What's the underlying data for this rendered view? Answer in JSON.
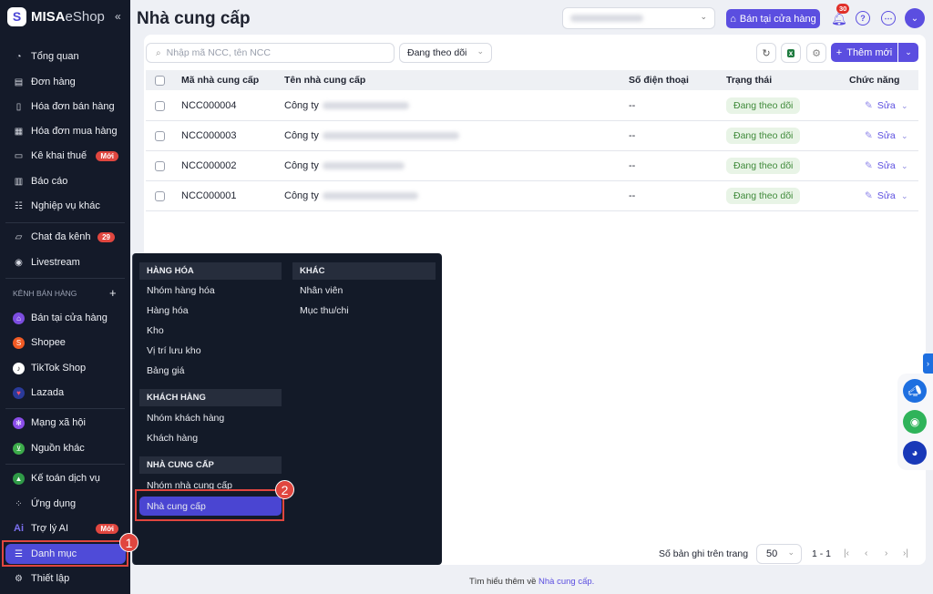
{
  "app": {
    "logo_mark": "S",
    "logo_brand": "MISA",
    "logo_product": "eShop",
    "collapse_icon": "«"
  },
  "sidebar": {
    "items": [
      {
        "label": "Tổng quan",
        "icon": "dashboard-icon"
      },
      {
        "label": "Đơn hàng",
        "icon": "order-icon"
      },
      {
        "label": "Hóa đơn bán hàng",
        "icon": "invoice-icon"
      },
      {
        "label": "Hóa đơn mua hàng",
        "icon": "receipt-icon"
      },
      {
        "label": "Kê khai thuế",
        "icon": "tax-icon",
        "badge": "Mới"
      },
      {
        "label": "Báo cáo",
        "icon": "report-icon"
      },
      {
        "label": "Nghiệp vụ khác",
        "icon": "list-icon"
      },
      {
        "label": "Chat đa kênh",
        "icon": "chat-icon",
        "badge": "29"
      },
      {
        "label": "Livestream",
        "icon": "livestream-icon"
      }
    ],
    "channels_label": "KÊNH BÁN HÀNG",
    "channels": [
      {
        "label": "Bán tại cửa hàng",
        "color": "#7c4de0"
      },
      {
        "label": "Shopee",
        "color": "#f05a24"
      },
      {
        "label": "TikTok Shop",
        "color": "#ffffff"
      },
      {
        "label": "Lazada",
        "color": "#2a3a9a"
      },
      {
        "label": "Mạng xã hội",
        "color": "#8a4de8"
      },
      {
        "label": "Nguồn khác",
        "color": "#3cab4a"
      }
    ],
    "bottom": [
      {
        "label": "Kế toán dịch vụ"
      },
      {
        "label": "Ứng dụng"
      },
      {
        "label": "Trợ lý AI",
        "badge": "Mới",
        "icon_text": "Ai"
      },
      {
        "label": "Danh mục"
      },
      {
        "label": "Thiết lập"
      }
    ]
  },
  "header": {
    "title": "Nhà cung cấp",
    "store_button": "Bán tại cửa hàng",
    "notification_count": "30",
    "help": "?",
    "more": "⋯"
  },
  "toolbar": {
    "search_placeholder": "Nhập mã NCC, tên NCC",
    "filter_value": "Đang theo dõi",
    "add_label": "Thêm mới"
  },
  "table": {
    "headers": [
      "Mã nhà cung cấp",
      "Tên nhà cung cấp",
      "Số điện thoại",
      "Trạng thái",
      "Chức năng"
    ],
    "rows": [
      {
        "code": "NCC000004",
        "name": "Công ty",
        "phone": "--",
        "status": "Đang theo dõi",
        "action": "Sửa"
      },
      {
        "code": "NCC000003",
        "name": "Công ty",
        "phone": "--",
        "status": "Đang theo dõi",
        "action": "Sửa"
      },
      {
        "code": "NCC000002",
        "name": "Công ty",
        "phone": "--",
        "status": "Đang theo dõi",
        "action": "Sửa"
      },
      {
        "code": "NCC000001",
        "name": "Công ty",
        "phone": "--",
        "status": "Đang theo dõi",
        "action": "Sửa"
      }
    ]
  },
  "pagination": {
    "label": "Số bản ghi trên trang",
    "page_size": "50",
    "range": "1 - 1"
  },
  "footer": {
    "text": "Tìm hiểu thêm về ",
    "link": "Nhà cung cấp."
  },
  "menu": {
    "goods": {
      "title": "HÀNG HÓA",
      "items": [
        "Nhóm hàng hóa",
        "Hàng hóa",
        "Kho",
        "Vị trí lưu kho",
        "Bảng giá"
      ]
    },
    "customers": {
      "title": "KHÁCH HÀNG",
      "items": [
        "Nhóm khách hàng",
        "Khách hàng"
      ]
    },
    "suppliers": {
      "title": "NHÀ CUNG CẤP",
      "items": [
        "Nhóm nhà cung cấp",
        "Nhà cung cấp"
      ]
    },
    "other": {
      "title": "KHÁC",
      "items": [
        "Nhân viên",
        "Mục thu/chi"
      ]
    }
  },
  "annotations": [
    "1",
    "2"
  ],
  "colors": {
    "accent": "#5b4ee0",
    "sidebar": "#141a29",
    "annotation": "#e0463f",
    "status_bg": "#e8f4e6"
  }
}
